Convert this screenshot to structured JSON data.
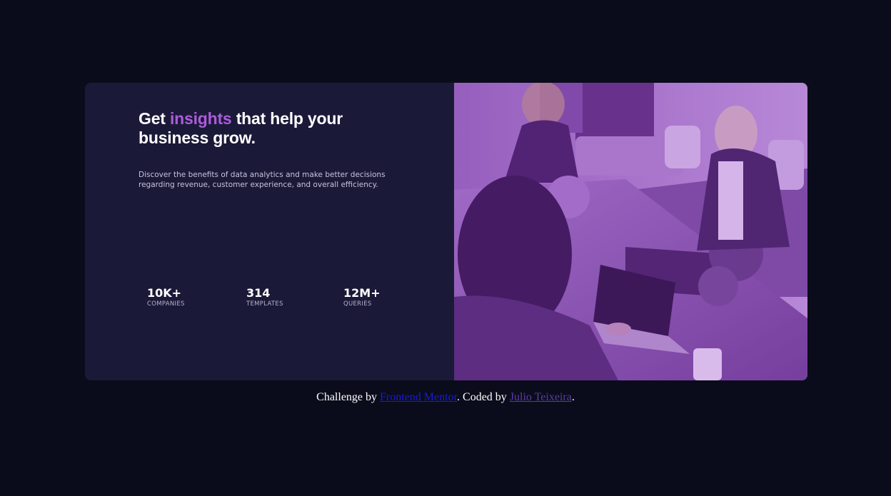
{
  "card": {
    "headline_before": "Get ",
    "headline_accent": "insights",
    "headline_after": " that help your business grow.",
    "description": "Discover the benefits of data analytics and make better decisions regarding revenue, customer experience, and overall efficiency.",
    "stats": [
      {
        "value": "10K+",
        "label": "COMPANIES"
      },
      {
        "value": "314",
        "label": "TEMPLATES"
      },
      {
        "value": "12M+",
        "label": "QUERIES"
      }
    ],
    "image_alt": "people working at a table with laptops",
    "colors": {
      "card_bg": "#1b1938",
      "accent": "#aa5cdb",
      "image_tint": "#8c5aaa"
    }
  },
  "footer": {
    "prefix": "Challenge by ",
    "link1": "Frontend Mentor",
    "middle": ". Coded by ",
    "link2": "Julio Teixeira",
    "suffix": "."
  },
  "page": {
    "background": "#0a0c1b"
  }
}
